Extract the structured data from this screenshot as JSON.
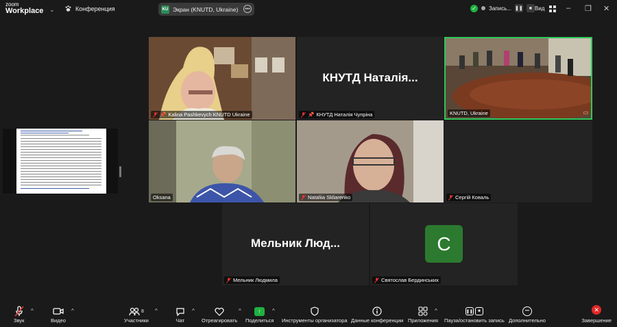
{
  "app": {
    "logo_top": "zoom",
    "logo_bottom": "Workplace",
    "conference_label": "Конференция",
    "screen_share_label": "Экран (KNUTD, Ukraine)",
    "screen_share_badge": "KU",
    "record_label": "Запись...",
    "view_label": "Вид"
  },
  "tiles": [
    {
      "name": "Kalina Pashkevych KNUTD Ukraine",
      "pinned": true,
      "muted": true
    },
    {
      "name": "КНУТД Наталія Чупріна",
      "big_name": "КНУТД  Наталія...",
      "pinned": true,
      "muted": true
    },
    {
      "name": "KNUTD, Ukraine",
      "active_speaker": true
    },
    {
      "name": "Oksana"
    },
    {
      "name": "Nataliia Skliarenko",
      "muted": true
    },
    {
      "name": "Сергій Коваль",
      "muted": true
    },
    {
      "name": "Мельник Людмила",
      "big_name": "Мельник  Люд...",
      "muted": true
    },
    {
      "name": "Святослав Бердинських",
      "avatar_letter": "C",
      "muted": true
    }
  ],
  "toolbar": {
    "audio": "Звук",
    "video": "Видео",
    "participants": "Участники",
    "participants_count": "8",
    "chat": "Чат",
    "reactions": "Отреагировать",
    "share": "Поделиться",
    "host_tools": "Инструменты организатора",
    "meeting_info": "Данные конференции",
    "apps": "Приложения",
    "pause_record": "Пауза/остановить запись",
    "more": "Дополнительно",
    "end": "Завершение"
  },
  "colors": {
    "accent_green": "#2fc85a",
    "avatar_green": "#2b7a2f",
    "end_red": "#e02828",
    "share_green": "#1fb141"
  }
}
